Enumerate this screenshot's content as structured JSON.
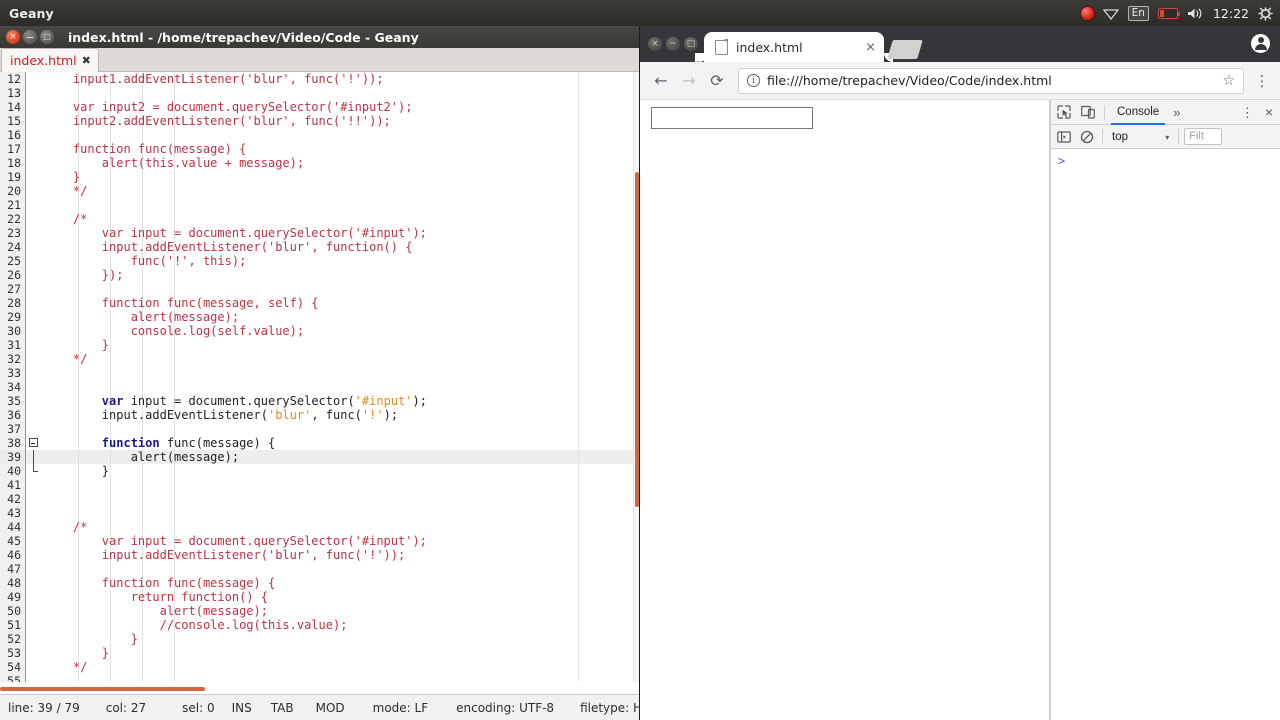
{
  "unity_panel": {
    "app_name": "Geany",
    "tray": {
      "record_icon": "record-dot-icon",
      "wifi_icon": "wifi-icon",
      "keyboard_layout": "En",
      "battery_icon": "battery-low-icon",
      "volume_icon": "volume-icon",
      "clock": "12:22",
      "power_icon": "power-gear-icon"
    }
  },
  "geany": {
    "window_title": "index.html - /home/trepachev/Video/Code - Geany",
    "window_buttons": {
      "close": "×",
      "minimize": "−",
      "maximize": "□"
    },
    "tab": {
      "label": "index.html",
      "close": "✖"
    },
    "editor": {
      "current_line": 39,
      "first_visible_line": 12,
      "lines": [
        {
          "n": 12,
          "tokens": [
            {
              "t": "    input1.addEventListener('blur', func('!'));",
              "c": "cm"
            }
          ]
        },
        {
          "n": 13,
          "tokens": []
        },
        {
          "n": 14,
          "tokens": [
            {
              "t": "    var input2 = document.querySelector('#input2');",
              "c": "cm"
            }
          ]
        },
        {
          "n": 15,
          "tokens": [
            {
              "t": "    input2.addEventListener('blur', func('!!'));",
              "c": "cm"
            }
          ]
        },
        {
          "n": 16,
          "tokens": []
        },
        {
          "n": 17,
          "tokens": [
            {
              "t": "    function func(message) {",
              "c": "cm"
            }
          ]
        },
        {
          "n": 18,
          "tokens": [
            {
              "t": "        alert(this.value + message);",
              "c": "cm"
            }
          ]
        },
        {
          "n": 19,
          "tokens": [
            {
              "t": "    }",
              "c": "cm"
            }
          ]
        },
        {
          "n": 20,
          "tokens": [
            {
              "t": "    */",
              "c": "cm"
            }
          ]
        },
        {
          "n": 21,
          "tokens": []
        },
        {
          "n": 22,
          "tokens": [
            {
              "t": "    /*",
              "c": "cm"
            }
          ]
        },
        {
          "n": 23,
          "tokens": [
            {
              "t": "        var input = document.querySelector('#input');",
              "c": "cm"
            }
          ]
        },
        {
          "n": 24,
          "tokens": [
            {
              "t": "        input.addEventListener('blur', function() {",
              "c": "cm"
            }
          ]
        },
        {
          "n": 25,
          "tokens": [
            {
              "t": "            func('!', this);",
              "c": "cm"
            }
          ]
        },
        {
          "n": 26,
          "tokens": [
            {
              "t": "        });",
              "c": "cm"
            }
          ]
        },
        {
          "n": 27,
          "tokens": []
        },
        {
          "n": 28,
          "tokens": [
            {
              "t": "        function func(message, self) {",
              "c": "cm"
            }
          ]
        },
        {
          "n": 29,
          "tokens": [
            {
              "t": "            alert(message);",
              "c": "cm"
            }
          ]
        },
        {
          "n": 30,
          "tokens": [
            {
              "t": "            console.log(self.value);",
              "c": "cm"
            }
          ]
        },
        {
          "n": 31,
          "tokens": [
            {
              "t": "        }",
              "c": "cm"
            }
          ]
        },
        {
          "n": 32,
          "tokens": [
            {
              "t": "    */",
              "c": "cm"
            }
          ]
        },
        {
          "n": 33,
          "tokens": []
        },
        {
          "n": 34,
          "tokens": []
        },
        {
          "n": 35,
          "tokens": [
            {
              "t": "        ",
              "c": "pl"
            },
            {
              "t": "var",
              "c": "kw"
            },
            {
              "t": " input = document.querySelector(",
              "c": "pl"
            },
            {
              "t": "'#input'",
              "c": "str"
            },
            {
              "t": ");",
              "c": "pl"
            }
          ]
        },
        {
          "n": 36,
          "tokens": [
            {
              "t": "        input.addEventListener(",
              "c": "pl"
            },
            {
              "t": "'blur'",
              "c": "str"
            },
            {
              "t": ", func(",
              "c": "pl"
            },
            {
              "t": "'!'",
              "c": "str"
            },
            {
              "t": ");",
              "c": "pl"
            }
          ]
        },
        {
          "n": 37,
          "tokens": []
        },
        {
          "n": 38,
          "tokens": [
            {
              "t": "        ",
              "c": "pl"
            },
            {
              "t": "function",
              "c": "kw"
            },
            {
              "t": " func(message) {",
              "c": "pl"
            }
          ],
          "fold": "open"
        },
        {
          "n": 39,
          "tokens": [
            {
              "t": "            alert(message);",
              "c": "pl"
            }
          ],
          "fold": "mid"
        },
        {
          "n": 40,
          "tokens": [
            {
              "t": "        }",
              "c": "pl"
            }
          ],
          "fold": "end"
        },
        {
          "n": 41,
          "tokens": []
        },
        {
          "n": 42,
          "tokens": []
        },
        {
          "n": 43,
          "tokens": []
        },
        {
          "n": 44,
          "tokens": [
            {
              "t": "    /*",
              "c": "cm"
            }
          ]
        },
        {
          "n": 45,
          "tokens": [
            {
              "t": "        var input = document.querySelector('#input');",
              "c": "cm"
            }
          ]
        },
        {
          "n": 46,
          "tokens": [
            {
              "t": "        input.addEventListener('blur', func('!'));",
              "c": "cm"
            }
          ]
        },
        {
          "n": 47,
          "tokens": []
        },
        {
          "n": 48,
          "tokens": [
            {
              "t": "        function func(message) {",
              "c": "cm"
            }
          ]
        },
        {
          "n": 49,
          "tokens": [
            {
              "t": "            return function() {",
              "c": "cm"
            }
          ]
        },
        {
          "n": 50,
          "tokens": [
            {
              "t": "                alert(message);",
              "c": "cm"
            }
          ]
        },
        {
          "n": 51,
          "tokens": [
            {
              "t": "                //console.log(this.value);",
              "c": "cm"
            }
          ]
        },
        {
          "n": 52,
          "tokens": [
            {
              "t": "            }",
              "c": "cm"
            }
          ]
        },
        {
          "n": 53,
          "tokens": [
            {
              "t": "        }",
              "c": "cm"
            }
          ]
        },
        {
          "n": 54,
          "tokens": [
            {
              "t": "    */",
              "c": "cm"
            }
          ]
        },
        {
          "n": 55,
          "tokens": []
        }
      ],
      "colors": {
        "comment": "#bb3344",
        "keyword": "#1a1a8c",
        "string": "#e08a1e",
        "plain": "#1e1e1e",
        "current_line_bg": "#eeeeee",
        "scrollbar": "#d2663d"
      }
    },
    "status_bar": {
      "line": "line: 39 / 79",
      "col": "col: 27",
      "sel": "sel: 0",
      "insert_mode": "INS",
      "indent": "TAB",
      "modified": "MOD",
      "eol": "mode: LF",
      "encoding": "encoding: UTF-8",
      "filetype": "filetype: H…"
    }
  },
  "chrome": {
    "window_buttons": {
      "close": "×",
      "minimize": "−",
      "maximize": "□"
    },
    "tab": {
      "title": "index.html",
      "favicon": "document-icon",
      "close": "×"
    },
    "new_tab_icon": "new-tab-icon",
    "profile_icon": "profile-avatar-icon",
    "toolbar": {
      "back": "←",
      "forward": "→",
      "reload": "⟳",
      "info_icon": "ⓘ",
      "url": "file:///home/trepachev/Video/Code/index.html",
      "star": "☆",
      "menu": "⋮"
    },
    "page": {
      "input_value": "",
      "input_placeholder": ""
    },
    "devtools": {
      "inspect_icon": "inspect-element-icon",
      "device_icon": "device-toolbar-icon",
      "active_tab": "Console",
      "more_tabs": "»",
      "kebab": "⋮",
      "close": "×",
      "sidebar_toggle_icon": "console-sidebar-icon",
      "clear_icon": "clear-console-icon",
      "context": "top",
      "context_arrow": "▾",
      "filter_placeholder": "Filt",
      "prompt_caret": ">"
    }
  }
}
